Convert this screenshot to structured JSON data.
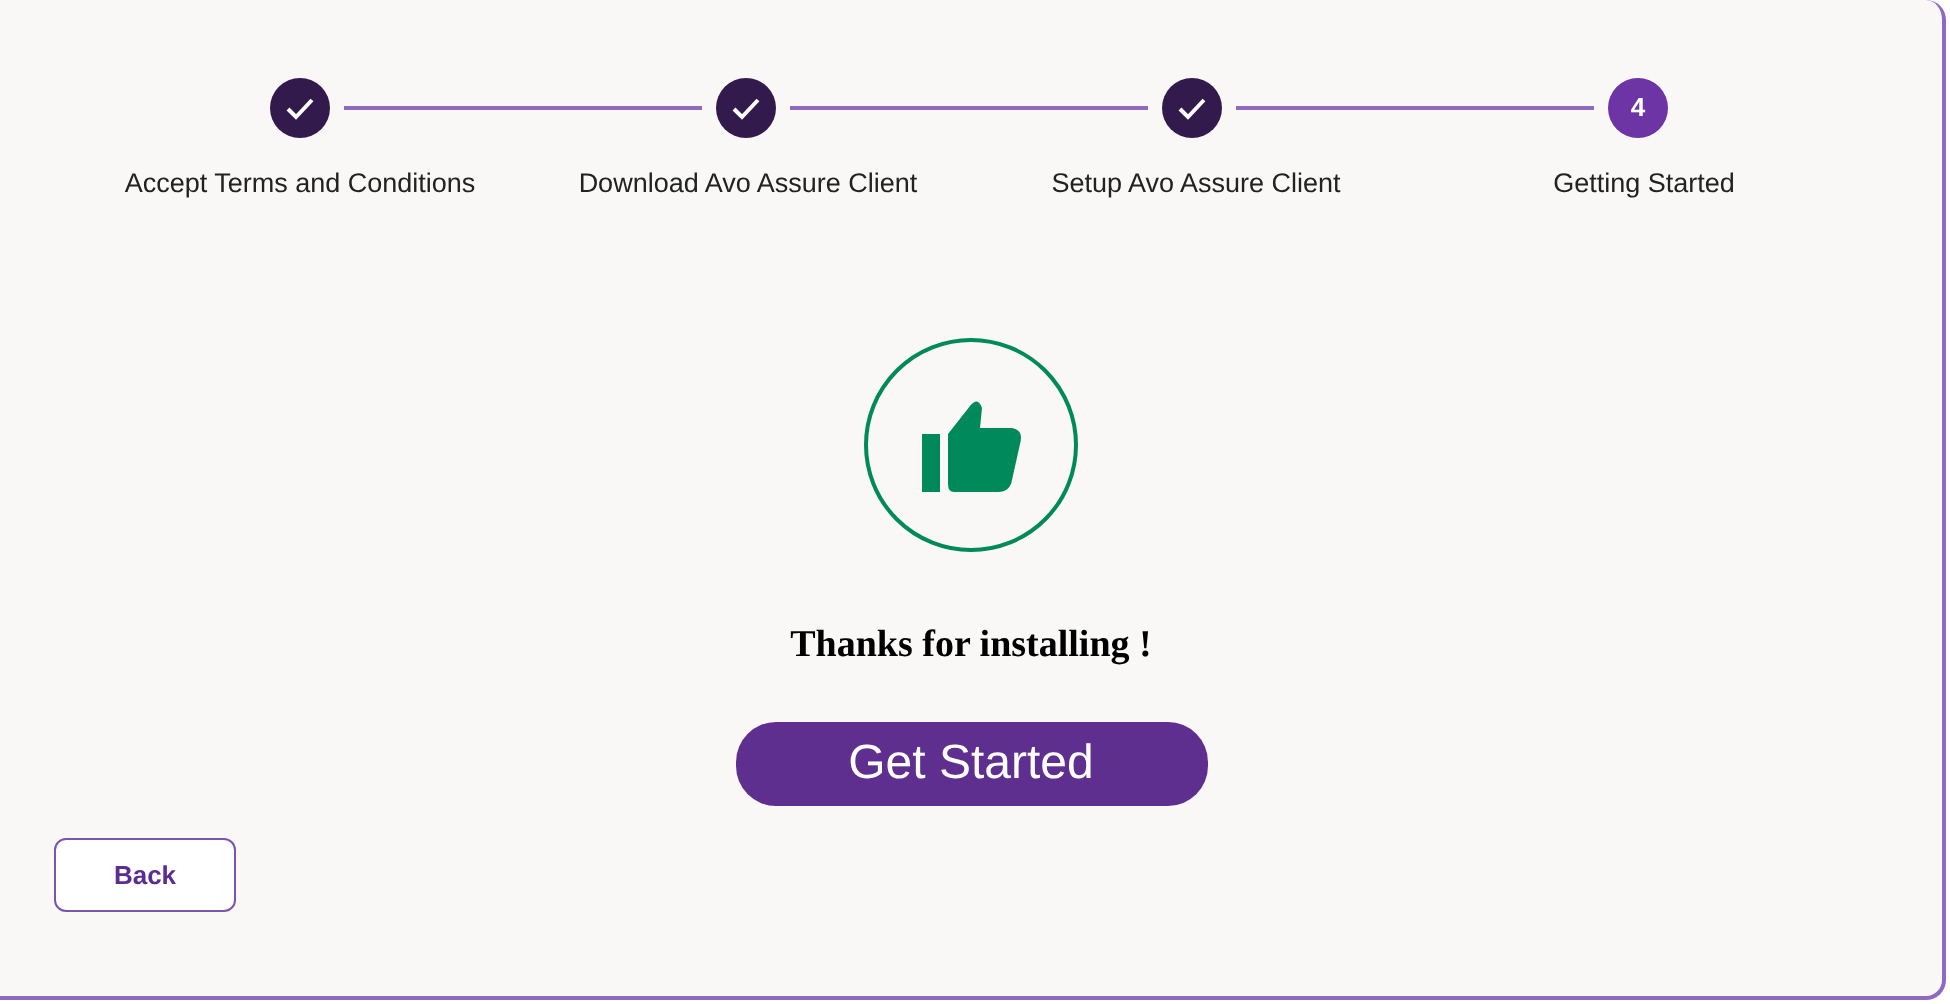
{
  "steps": [
    {
      "label": "Accept Terms and Conditions",
      "completed": true
    },
    {
      "label": "Download Avo Assure Client",
      "completed": true
    },
    {
      "label": "Setup Avo Assure Client",
      "completed": true
    },
    {
      "label": "Getting Started",
      "completed": false,
      "number": "4"
    }
  ],
  "message": "Thanks for installing !",
  "primary_button": "Get Started",
  "back_button": "Back"
}
